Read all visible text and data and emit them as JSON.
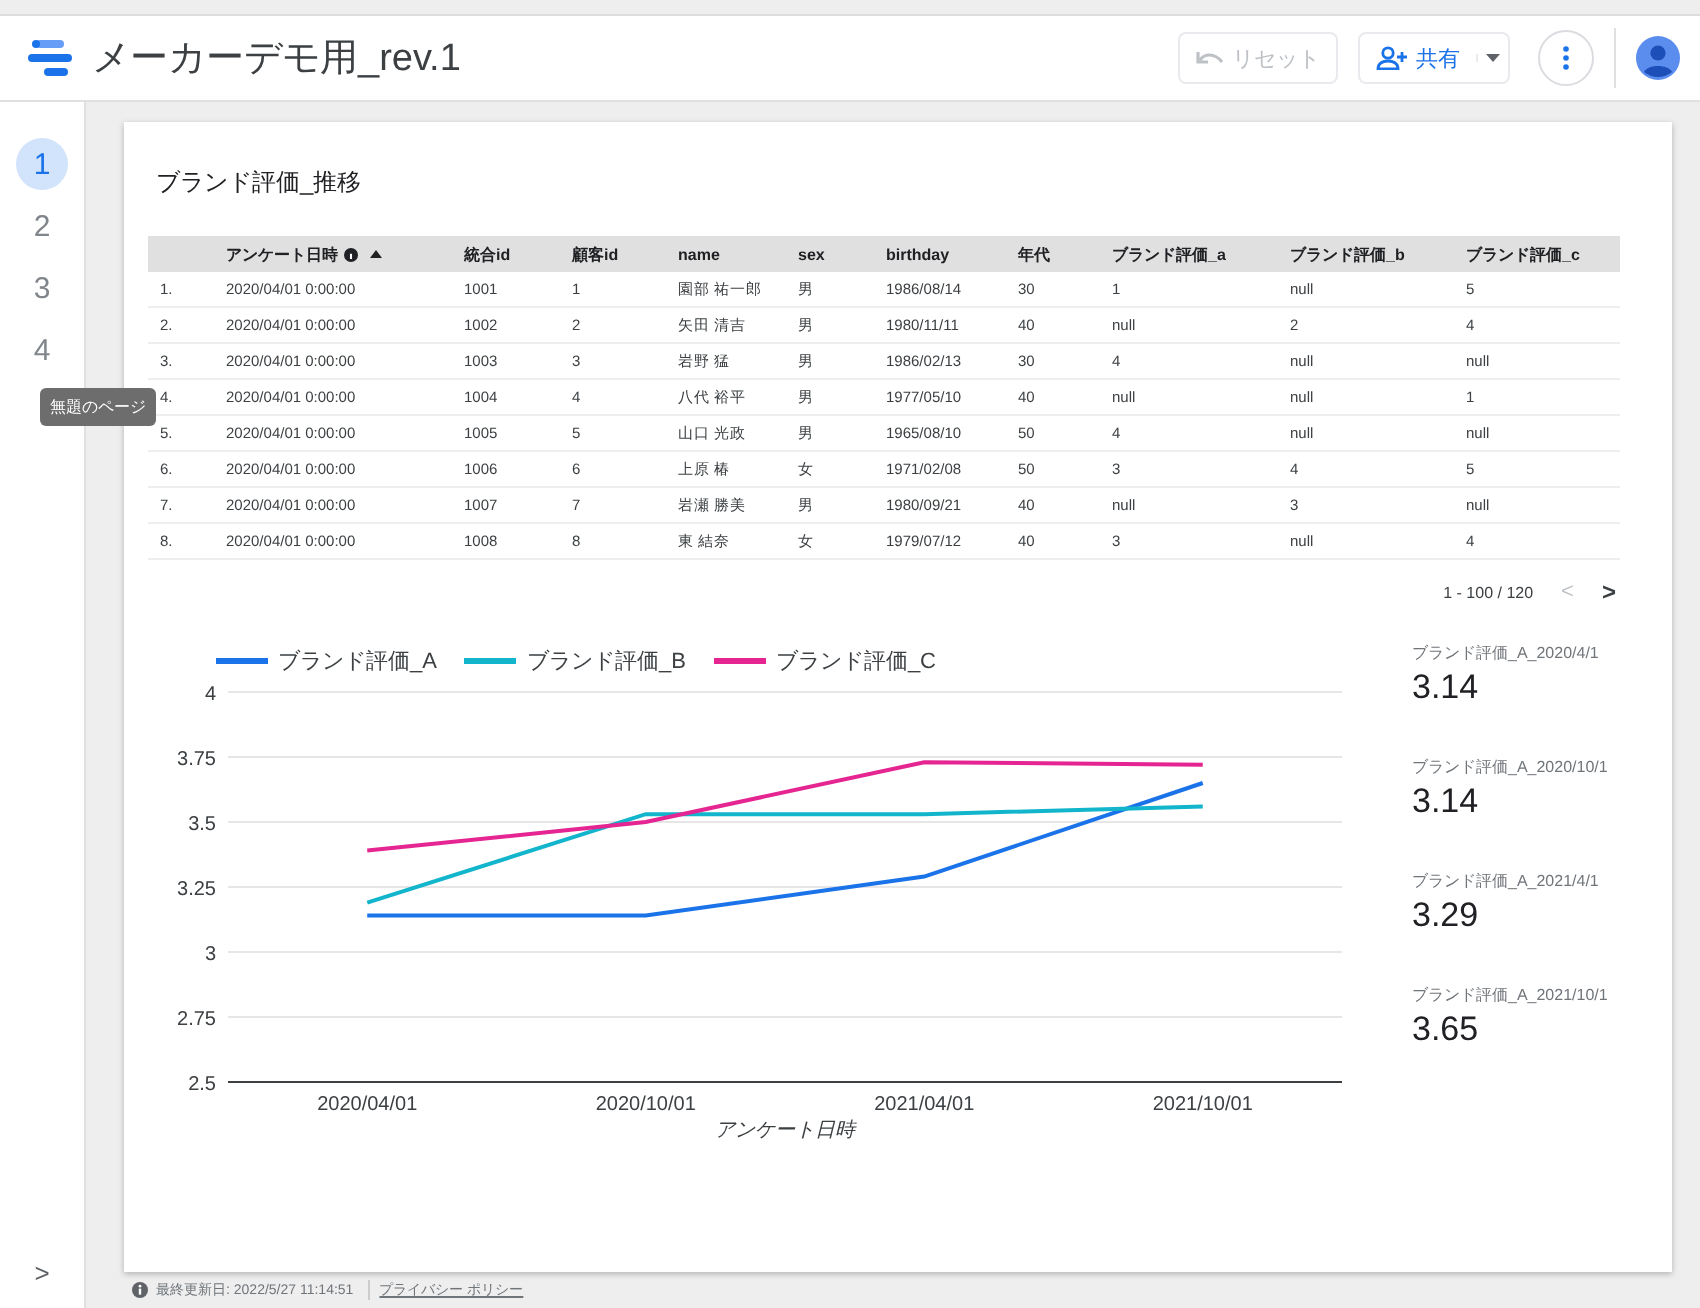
{
  "header": {
    "title": "メーカーデモ用_rev.1",
    "reset_button": "リセット",
    "share_button": "共有"
  },
  "pages": [
    {
      "label": "1",
      "selected": true
    },
    {
      "label": "2",
      "selected": false
    },
    {
      "label": "3",
      "selected": false
    },
    {
      "label": "4",
      "selected": false
    }
  ],
  "tooltip": "無題のページ",
  "nav_toggle": ">",
  "report": {
    "title": "ブランド評価_推移",
    "table": {
      "columns": [
        "",
        "アンケート日時",
        "統合id",
        "顧客id",
        "name",
        "sex",
        "birthday",
        "年代",
        "ブランド評価_a",
        "ブランド評価_b",
        "ブランド評価_c"
      ],
      "rows": [
        [
          "1.",
          "2020/04/01 0:00:00",
          "1001",
          "1",
          "園部 祐一郎",
          "男",
          "1986/08/14",
          "30",
          "1",
          "null",
          "5"
        ],
        [
          "2.",
          "2020/04/01 0:00:00",
          "1002",
          "2",
          "矢田 清吉",
          "男",
          "1980/11/11",
          "40",
          "null",
          "2",
          "4"
        ],
        [
          "3.",
          "2020/04/01 0:00:00",
          "1003",
          "3",
          "岩野 猛",
          "男",
          "1986/02/13",
          "30",
          "4",
          "null",
          "null"
        ],
        [
          "4.",
          "2020/04/01 0:00:00",
          "1004",
          "4",
          "八代 裕平",
          "男",
          "1977/05/10",
          "40",
          "null",
          "null",
          "1"
        ],
        [
          "5.",
          "2020/04/01 0:00:00",
          "1005",
          "5",
          "山口 光政",
          "男",
          "1965/08/10",
          "50",
          "4",
          "null",
          "null"
        ],
        [
          "6.",
          "2020/04/01 0:00:00",
          "1006",
          "6",
          "上原 椿",
          "女",
          "1971/02/08",
          "50",
          "3",
          "4",
          "5"
        ],
        [
          "7.",
          "2020/04/01 0:00:00",
          "1007",
          "7",
          "岩瀬 勝美",
          "男",
          "1980/09/21",
          "40",
          "null",
          "3",
          "null"
        ],
        [
          "8.",
          "2020/04/01 0:00:00",
          "1008",
          "8",
          "東 結奈",
          "女",
          "1979/07/12",
          "40",
          "3",
          "null",
          "4"
        ]
      ],
      "pagination": "1 - 100 / 120",
      "prev": "<",
      "next": ">"
    },
    "chart": {
      "chart_data": {
        "type": "line",
        "grid": true,
        "xlabel": "アンケート日時",
        "categories": [
          "2020/04/01",
          "2020/10/01",
          "2021/04/01",
          "2021/10/01"
        ],
        "series": [
          {
            "name": "ブランド評価_A",
            "color": "#1a73e8",
            "values": [
              3.14,
              3.14,
              3.29,
              3.65
            ]
          },
          {
            "name": "ブランド評価_B",
            "color": "#12b5cb",
            "values": [
              3.19,
              3.53,
              3.53,
              3.56
            ]
          },
          {
            "name": "ブランド評価_C",
            "color": "#e52592",
            "values": [
              3.39,
              3.5,
              3.73,
              3.72
            ]
          }
        ],
        "ylim": [
          2.5,
          4
        ],
        "yticks": [
          {
            "value": 2.5,
            "label": "2.5"
          },
          {
            "value": 2.75,
            "label": "2.75"
          },
          {
            "value": 3,
            "label": "3"
          },
          {
            "value": 3.25,
            "label": "3.25"
          },
          {
            "value": 3.5,
            "label": "3.5"
          },
          {
            "value": 3.75,
            "label": "3.75"
          },
          {
            "value": 4,
            "label": "4"
          }
        ]
      }
    },
    "scorecards": [
      {
        "label": "ブランド評価_A_2020/4/1",
        "value": "3.14"
      },
      {
        "label": "ブランド評価_A_2020/10/1",
        "value": "3.14"
      },
      {
        "label": "ブランド評価_A_2021/4/1",
        "value": "3.29"
      },
      {
        "label": "ブランド評価_A_2021/10/1",
        "value": "3.65"
      }
    ]
  },
  "footer": {
    "updated": "最終更新日: 2022/5/27 11:14:51",
    "privacy_link": "プライバシー ポリシー"
  }
}
